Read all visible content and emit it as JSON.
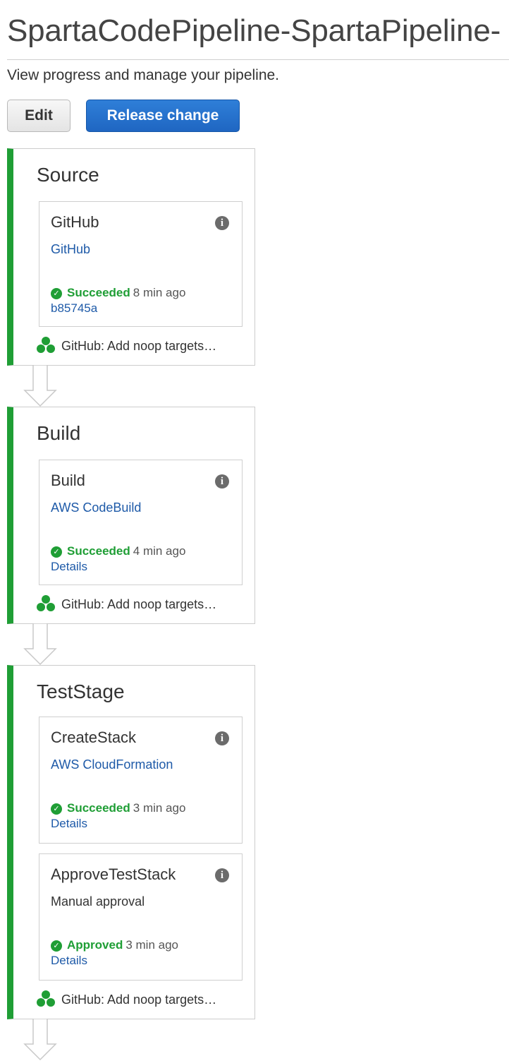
{
  "page": {
    "title": "SpartaCodePipeline-SpartaPipeline-",
    "subtitle": "View progress and manage your pipeline."
  },
  "toolbar": {
    "edit_label": "Edit",
    "release_label": "Release change"
  },
  "colors": {
    "accent_green": "#1f9e35",
    "link_blue": "#1e5aa8",
    "primary_button": "#1f66c2"
  },
  "stages": [
    {
      "name": "Source",
      "revision": "GitHub: Add noop targets…",
      "actions": [
        {
          "name": "GitHub",
          "provider": "GitHub",
          "status": "Succeeded",
          "time": "8 min ago",
          "link": "b85745a"
        }
      ]
    },
    {
      "name": "Build",
      "revision": "GitHub: Add noop targets…",
      "actions": [
        {
          "name": "Build",
          "provider": "AWS CodeBuild",
          "status": "Succeeded",
          "time": "4 min ago",
          "link": "Details"
        }
      ]
    },
    {
      "name": "TestStage",
      "revision": "GitHub: Add noop targets…",
      "actions": [
        {
          "name": "CreateStack",
          "provider": "AWS CloudFormation",
          "status": "Succeeded",
          "time": "3 min ago",
          "link": "Details"
        },
        {
          "name": "ApproveTestStack",
          "provider": "Manual approval",
          "status": "Approved",
          "time": "3 min ago",
          "link": "Details"
        }
      ]
    }
  ],
  "icons": {
    "info": "info-icon",
    "status": "check-circle-icon",
    "revision": "revision-cluster-icon",
    "transition": "down-arrow-icon"
  }
}
